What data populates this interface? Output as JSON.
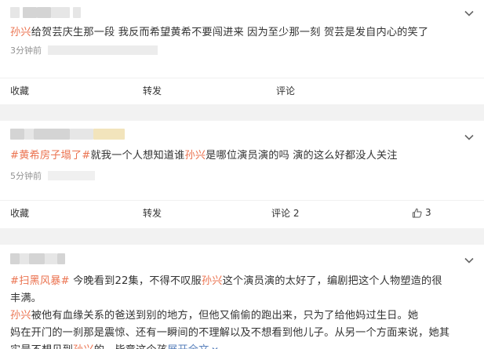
{
  "posts": [
    {
      "segments": [
        {
          "t": "孙兴",
          "c": "hl"
        },
        {
          "t": "给贺芸庆生那一段 我反而希望黄希不要闯进来 因为至少那一刻 贺芸是发自内心的笑了",
          "c": ""
        }
      ],
      "time": "3分钟前",
      "actions": {
        "favorite": "收藏",
        "repost": "转发",
        "comment": "评论"
      }
    },
    {
      "segments": [
        {
          "t": "#黄希房子塌了#",
          "c": "tag"
        },
        {
          "t": "就我一个人想知道谁",
          "c": ""
        },
        {
          "t": "孙兴",
          "c": "hl"
        },
        {
          "t": "是哪位演员演的吗 演的这么好都没人关注",
          "c": ""
        }
      ],
      "time": "5分钟前",
      "actions": {
        "favorite": "收藏",
        "repost": "转发",
        "comment": "评论 2",
        "like": "3"
      }
    },
    {
      "line1": [
        {
          "t": "#扫黑风暴#",
          "c": "tag"
        },
        {
          "t": " 今晚看到22集，不得不叹服",
          "c": ""
        },
        {
          "t": "孙兴",
          "c": "hl"
        },
        {
          "t": "这个演员演的太好了，编剧把这个人物塑造的很",
          "c": ""
        }
      ],
      "line2": [
        {
          "t": "丰满。",
          "c": ""
        }
      ],
      "line3": [
        {
          "t": "孙兴",
          "c": "hl"
        },
        {
          "t": "被他有血缘关系的爸送到别的地方，但他又偷偷的跑出来，只为了给他妈过生日。她",
          "c": ""
        }
      ],
      "line4": [
        {
          "t": "妈在开门的一刹那是震惊、还有一瞬间的不理解以及不想看到他儿子。从另一个方面来说，她其",
          "c": ""
        }
      ],
      "line5": [
        {
          "t": "实是不想见到",
          "c": ""
        },
        {
          "t": "孙兴",
          "c": "hl"
        },
        {
          "t": "的，毕竟这个孩 ",
          "c": ""
        },
        {
          "t": "展开全文",
          "c": "more"
        }
      ]
    }
  ],
  "icons": {
    "chevron": "chevron-down-icon",
    "like": "thumbs-up-icon",
    "expand": "expand-chevron-icon"
  }
}
